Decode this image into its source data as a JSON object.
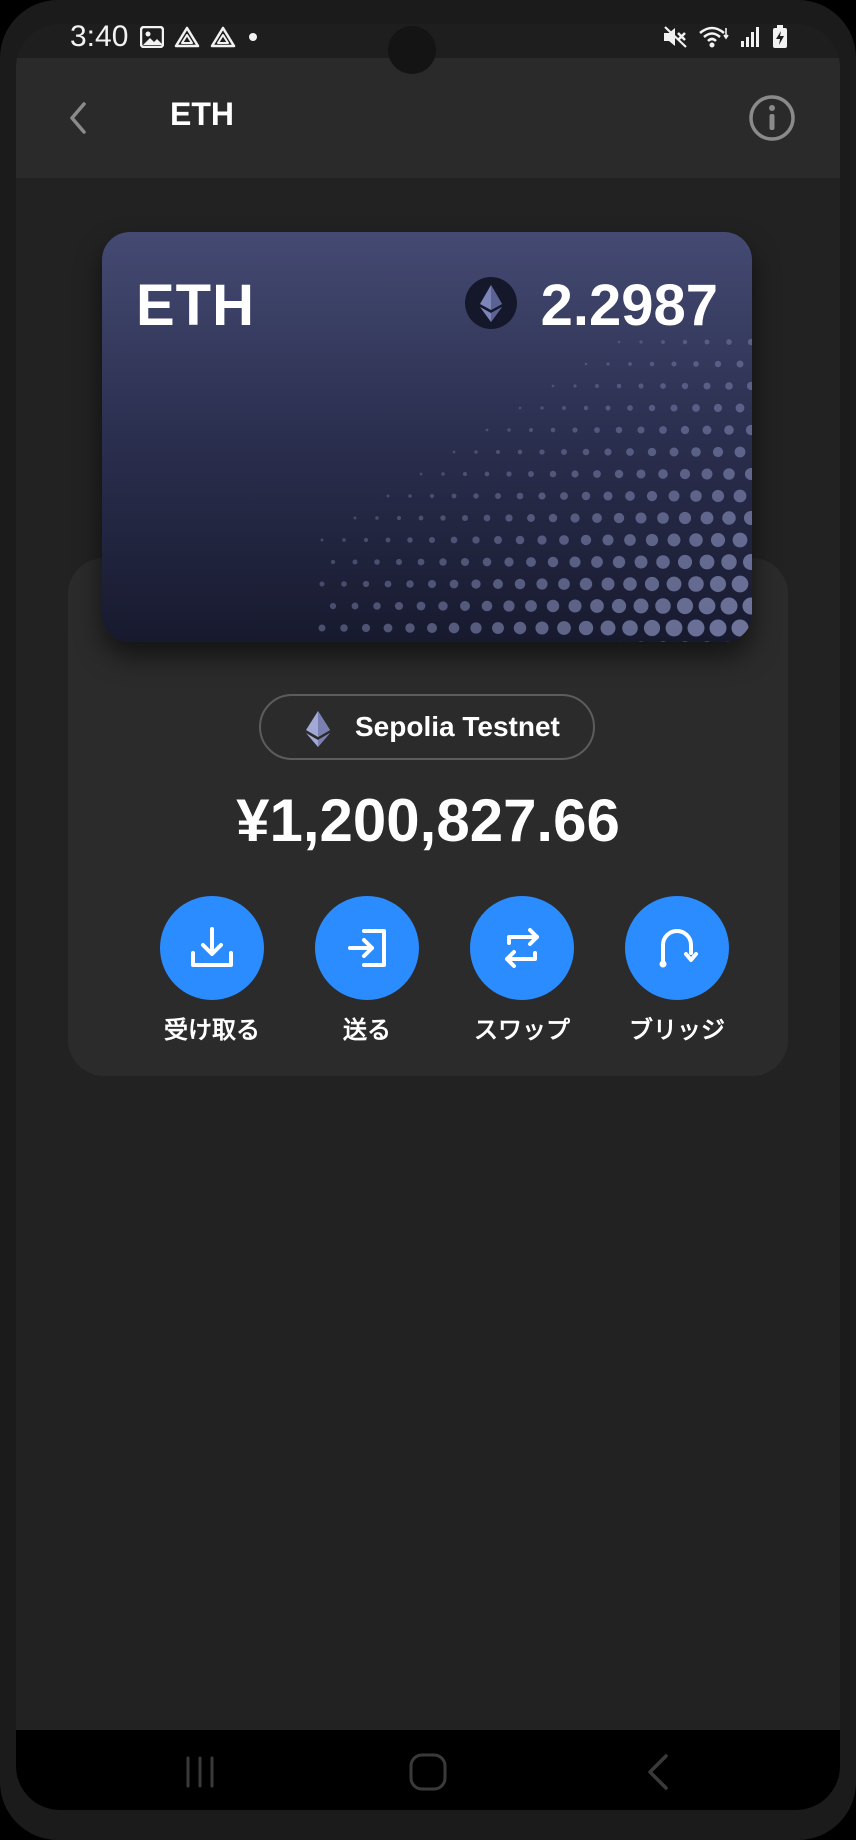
{
  "status_bar": {
    "time": "3:40",
    "left_icons": [
      "image-icon",
      "drive-icon",
      "drive-icon",
      "dot-icon"
    ],
    "right_icons": [
      "mute-icon",
      "wifi-icon",
      "signal-icon",
      "battery-charging-icon"
    ]
  },
  "app_bar": {
    "title": "ETH",
    "back_icon": "chevron-left-icon",
    "info_icon": "info-icon"
  },
  "token_card": {
    "symbol": "ETH",
    "icon": "ethereum-icon",
    "balance": "2.2987"
  },
  "network": {
    "icon": "ethereum-icon",
    "name": "Sepolia Testnet"
  },
  "fiat_value": "¥1,200,827.66",
  "actions": [
    {
      "label": "受け取る",
      "icon": "receive-icon"
    },
    {
      "label": "送る",
      "icon": "send-icon"
    },
    {
      "label": "スワップ",
      "icon": "swap-icon"
    },
    {
      "label": "ブリッジ",
      "icon": "bridge-icon"
    }
  ],
  "nav_bar": {
    "items": [
      "recents-icon",
      "home-icon",
      "back-icon"
    ]
  },
  "colors": {
    "background": "#222222",
    "app_bar": "#2a2a2a",
    "panel": "#2b2b2b",
    "accent": "#2a8cff",
    "card_top": "#454a73",
    "card_bottom": "#171a2e"
  }
}
